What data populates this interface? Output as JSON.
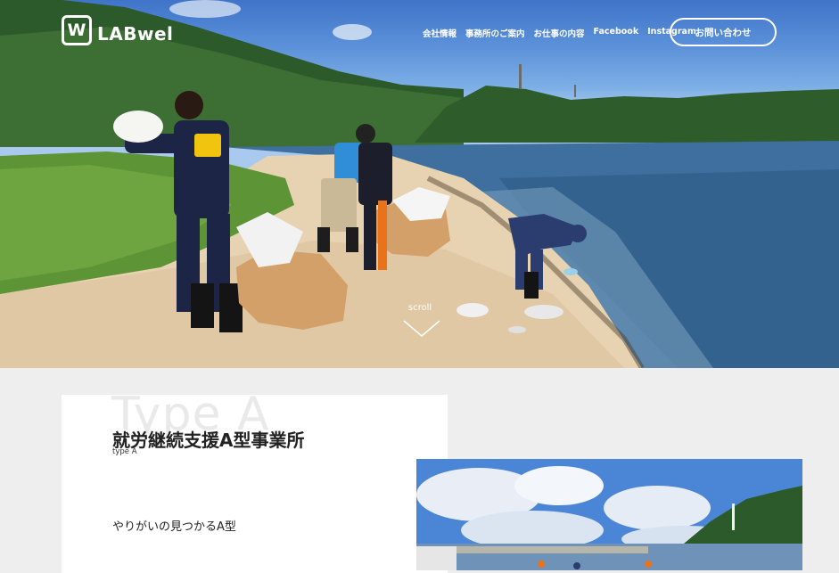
{
  "brand": {
    "logo_mark": "W",
    "logo_text": "LABwel"
  },
  "nav": {
    "items": [
      "会社情報",
      "事務所のご案内",
      "お仕事の内容",
      "Facebook",
      "Instagram"
    ],
    "contact_label": "お問い合わせ"
  },
  "hero": {
    "scroll_label": "scroll",
    "uniform_logo": "LABwel"
  },
  "section": {
    "watermark": "Type A",
    "title": "就労継続支援A型事業所",
    "subtitle": "type A",
    "tagline": "やりがいの見つかるA型"
  },
  "colors": {
    "sky": "#3f74c9",
    "sea": "#3e6f9e",
    "sand": "#e7d3b2",
    "page_bg": "#eeeeee"
  }
}
